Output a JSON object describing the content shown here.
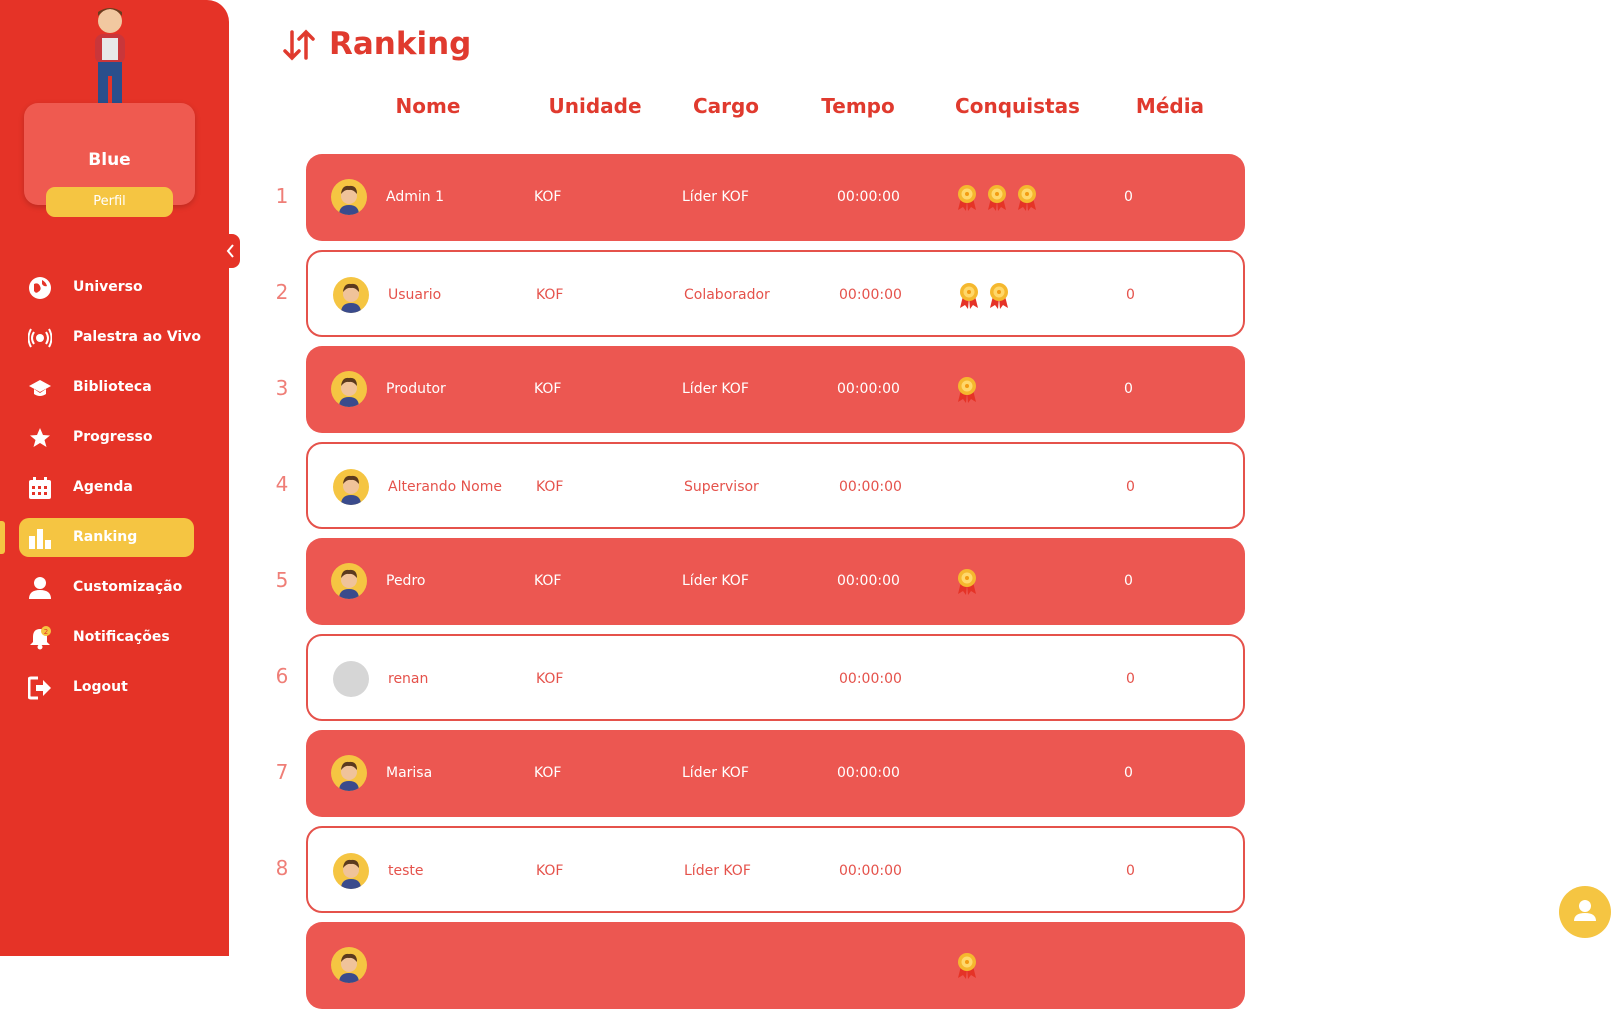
{
  "sidebar": {
    "profile": {
      "name": "Blue",
      "button": "Perfil"
    },
    "items": [
      {
        "label": "Universo",
        "icon": "globe-icon",
        "active": false
      },
      {
        "label": "Palestra ao Vivo",
        "icon": "broadcast-icon",
        "active": false
      },
      {
        "label": "Biblioteca",
        "icon": "graduation-cap-icon",
        "active": false
      },
      {
        "label": "Progresso",
        "icon": "star-icon",
        "active": false
      },
      {
        "label": "Agenda",
        "icon": "calendar-icon",
        "active": false
      },
      {
        "label": "Ranking",
        "icon": "bar-chart-icon",
        "active": true
      },
      {
        "label": "Customização",
        "icon": "user-icon",
        "active": false
      },
      {
        "label": "Notificações",
        "icon": "bell-icon",
        "active": false,
        "badge": "2"
      },
      {
        "label": "Logout",
        "icon": "logout-icon",
        "active": false
      }
    ]
  },
  "main": {
    "title": "Ranking",
    "columns": [
      "Nome",
      "Unidade",
      "Cargo",
      "Tempo",
      "Conquistas",
      "Média"
    ],
    "rows": [
      {
        "rank": "1",
        "name": "Admin 1",
        "unidade": "KOF",
        "cargo": "Líder KOF",
        "tempo": "00:00:00",
        "medals": 3,
        "media": "0",
        "style": "filled"
      },
      {
        "rank": "2",
        "name": "Usuario",
        "unidade": "KOF",
        "cargo": "Colaborador",
        "tempo": "00:00:00",
        "medals": 2,
        "media": "0",
        "style": "outline"
      },
      {
        "rank": "3",
        "name": "Produtor",
        "unidade": "KOF",
        "cargo": "Líder KOF",
        "tempo": "00:00:00",
        "medals": 1,
        "media": "0",
        "style": "filled"
      },
      {
        "rank": "4",
        "name": "Alterando Nome",
        "unidade": "KOF",
        "cargo": "Supervisor",
        "tempo": "00:00:00",
        "medals": 0,
        "media": "0",
        "style": "outline"
      },
      {
        "rank": "5",
        "name": "Pedro",
        "unidade": "KOF",
        "cargo": "Líder KOF",
        "tempo": "00:00:00",
        "medals": 1,
        "media": "0",
        "style": "filled"
      },
      {
        "rank": "6",
        "name": "renan",
        "unidade": "KOF",
        "cargo": "",
        "tempo": "00:00:00",
        "medals": 0,
        "media": "0",
        "style": "outline"
      },
      {
        "rank": "7",
        "name": "Marisa",
        "unidade": "KOF",
        "cargo": "Líder KOF",
        "tempo": "00:00:00",
        "medals": 0,
        "media": "0",
        "style": "filled"
      },
      {
        "rank": "8",
        "name": "teste",
        "unidade": "KOF",
        "cargo": "Líder KOF",
        "tempo": "00:00:00",
        "medals": 0,
        "media": "0",
        "style": "outline"
      },
      {
        "rank": "",
        "name": "",
        "unidade": "",
        "cargo": "",
        "tempo": "",
        "medals": 1,
        "media": "",
        "style": "filled"
      }
    ]
  },
  "colors": {
    "primary": "#e53327",
    "row": "#ec5751",
    "accent": "#f5c542"
  }
}
